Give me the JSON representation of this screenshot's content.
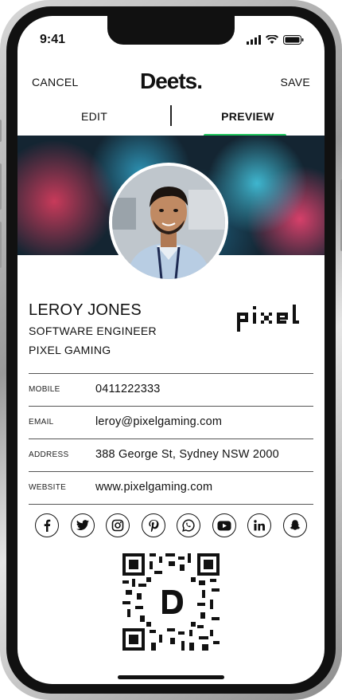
{
  "status": {
    "time": "9:41"
  },
  "header": {
    "cancel": "CANCEL",
    "logo": "Deets.",
    "save": "SAVE"
  },
  "tabs": [
    {
      "label": "EDIT"
    },
    {
      "label": "PREVIEW",
      "active": true
    }
  ],
  "profile": {
    "name": "LEROY JONES",
    "title": "SOFTWARE ENGINEER",
    "company": "PIXEL GAMING",
    "company_logo_text": "pixel"
  },
  "contact": [
    {
      "label": "MOBILE",
      "value": "0411222333"
    },
    {
      "label": "EMAIL",
      "value": "leroy@pixelgaming.com"
    },
    {
      "label": "ADDRESS",
      "value": "388 George St, Sydney NSW 2000"
    },
    {
      "label": "WEBSITE",
      "value": "www.pixelgaming.com"
    }
  ],
  "socials": [
    "facebook-icon",
    "twitter-icon",
    "instagram-icon",
    "pinterest-icon",
    "whatsapp-icon",
    "youtube-icon",
    "linkedin-icon",
    "snapchat-icon"
  ],
  "colors": {
    "accent": "#22c55e",
    "text": "#111111"
  }
}
